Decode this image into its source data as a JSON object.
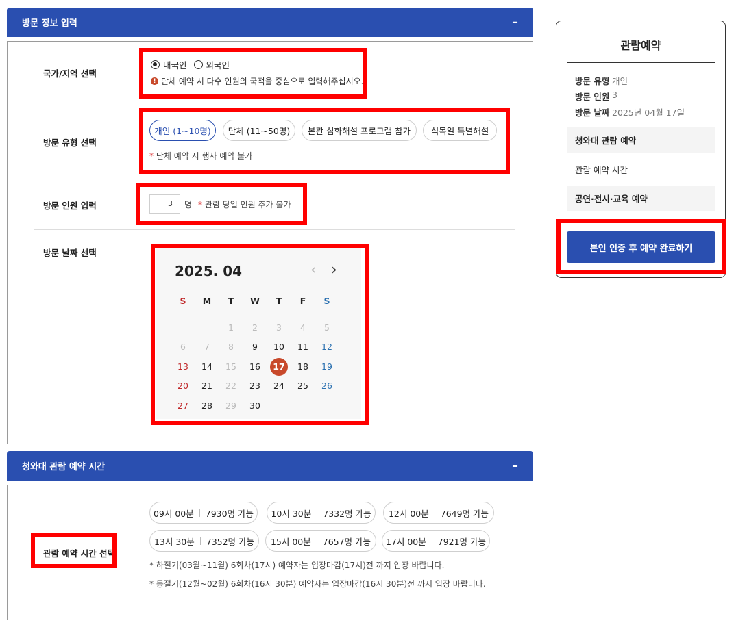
{
  "visit_info": {
    "header": "방문 정보 입력",
    "collapse": "–",
    "country": {
      "label": "국가/지역 선택",
      "options": [
        "내국인",
        "외국인"
      ],
      "selected": "내국인",
      "notice": "단체 예약 시 다수 인원의 국적을 중심으로 입력해주십시오.",
      "notice_icon": "!"
    },
    "visit_type": {
      "label": "방문 유형 선택",
      "options": [
        "개인 (1~10명)",
        "단체 (11~50명)",
        "본관 심화해설 프로그램 참가",
        "식목일 특별해설"
      ],
      "selected": "개인 (1~10명)",
      "note_star": "*",
      "note": "단체 예약 시 행사 예약 불가"
    },
    "count": {
      "label": "방문 인원 입력",
      "value": "3",
      "unit": "명",
      "note_star": "*",
      "note": "관람 당일 인원 추가 불가"
    },
    "date": {
      "label": "방문 날짜 선택",
      "calendar": {
        "title": "2025. 04",
        "prev": "‹",
        "next": "›",
        "dow": [
          "S",
          "M",
          "T",
          "W",
          "T",
          "F",
          "S"
        ],
        "selected_day": "17",
        "weeks": [
          [
            {
              "d": "",
              "t": "blank"
            },
            {
              "d": "",
              "t": "blank"
            },
            {
              "d": "1",
              "t": "disabled"
            },
            {
              "d": "2",
              "t": "disabled"
            },
            {
              "d": "3",
              "t": "disabled"
            },
            {
              "d": "4",
              "t": "disabled"
            },
            {
              "d": "5",
              "t": "disabled"
            }
          ],
          [
            {
              "d": "6",
              "t": "disabled"
            },
            {
              "d": "7",
              "t": "disabled"
            },
            {
              "d": "8",
              "t": "disabled"
            },
            {
              "d": "9",
              "t": "normal"
            },
            {
              "d": "10",
              "t": "normal"
            },
            {
              "d": "11",
              "t": "normal"
            },
            {
              "d": "12",
              "t": "sat"
            }
          ],
          [
            {
              "d": "13",
              "t": "sun"
            },
            {
              "d": "14",
              "t": "normal"
            },
            {
              "d": "15",
              "t": "disabled"
            },
            {
              "d": "16",
              "t": "normal"
            },
            {
              "d": "17",
              "t": "selected"
            },
            {
              "d": "18",
              "t": "normal"
            },
            {
              "d": "19",
              "t": "sat"
            }
          ],
          [
            {
              "d": "20",
              "t": "sun"
            },
            {
              "d": "21",
              "t": "normal"
            },
            {
              "d": "22",
              "t": "disabled"
            },
            {
              "d": "23",
              "t": "normal"
            },
            {
              "d": "24",
              "t": "normal"
            },
            {
              "d": "25",
              "t": "normal"
            },
            {
              "d": "26",
              "t": "sat"
            }
          ],
          [
            {
              "d": "27",
              "t": "sun"
            },
            {
              "d": "28",
              "t": "normal"
            },
            {
              "d": "29",
              "t": "disabled"
            },
            {
              "d": "30",
              "t": "normal"
            },
            {
              "d": "",
              "t": "blank"
            },
            {
              "d": "",
              "t": "blank"
            },
            {
              "d": "",
              "t": "blank"
            }
          ]
        ]
      }
    }
  },
  "time_section": {
    "header": "청와대 관람 예약 시간",
    "collapse": "–",
    "label": "관람 예약 시간 선택",
    "slots": [
      {
        "time": "09시 00분",
        "avail": "7930명 가능"
      },
      {
        "time": "10시 30분",
        "avail": "7332명 가능"
      },
      {
        "time": "12시 00분",
        "avail": "7649명 가능"
      },
      {
        "time": "13시 30분",
        "avail": "7352명 가능"
      },
      {
        "time": "15시 00분",
        "avail": "7657명 가능"
      },
      {
        "time": "17시 00분",
        "avail": "7921명 가능"
      }
    ],
    "notes": [
      "* 하절기(03월~11월) 6회차(17시) 예약자는 입장마감(17시)전 까지 입장 바랍니다.",
      "* 동절기(12월~02월) 6회차(16시 30분) 예약자는 입장마감(16시 30분)전 까지 입장 바랍니다."
    ]
  },
  "sidebar": {
    "title": "관람예약",
    "info": [
      {
        "key": "방문 유형",
        "value": "개인"
      },
      {
        "key": "방문 인원",
        "value": "3"
      },
      {
        "key": "방문 날짜",
        "value": "2025년 04월 17일"
      }
    ],
    "box1": "청와대 관람 예약",
    "plain": "관람 예약 시간",
    "box2": "공연·전시·교육 예약",
    "button": "본인 인증 후 예약 완료하기"
  },
  "colors": {
    "primary": "#2a4fb0",
    "highlight": "#ff0000",
    "selected_day": "#c8492b",
    "sunday": "#c0292b",
    "saturday": "#2a70b0",
    "disabled": "#bbbbbb"
  }
}
